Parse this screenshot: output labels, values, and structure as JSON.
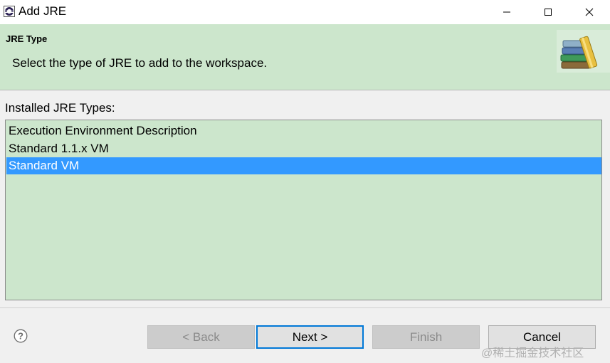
{
  "window": {
    "title": "Add JRE"
  },
  "banner": {
    "title": "JRE Type",
    "description": "Select the type of JRE to add to the workspace.",
    "icon": "books-icon"
  },
  "list": {
    "label": "Installed JRE Types:",
    "items": [
      {
        "label": "Execution Environment Description",
        "selected": false
      },
      {
        "label": "Standard 1.1.x VM",
        "selected": false
      },
      {
        "label": "Standard VM",
        "selected": true
      }
    ]
  },
  "buttons": {
    "back": "< Back",
    "next": "Next >",
    "finish": "Finish",
    "cancel": "Cancel"
  },
  "watermark": "@稀土掘金技术社区",
  "colors": {
    "banner_bg": "#cce6cc",
    "selection": "#3399ff",
    "default_border": "#0078d7"
  }
}
